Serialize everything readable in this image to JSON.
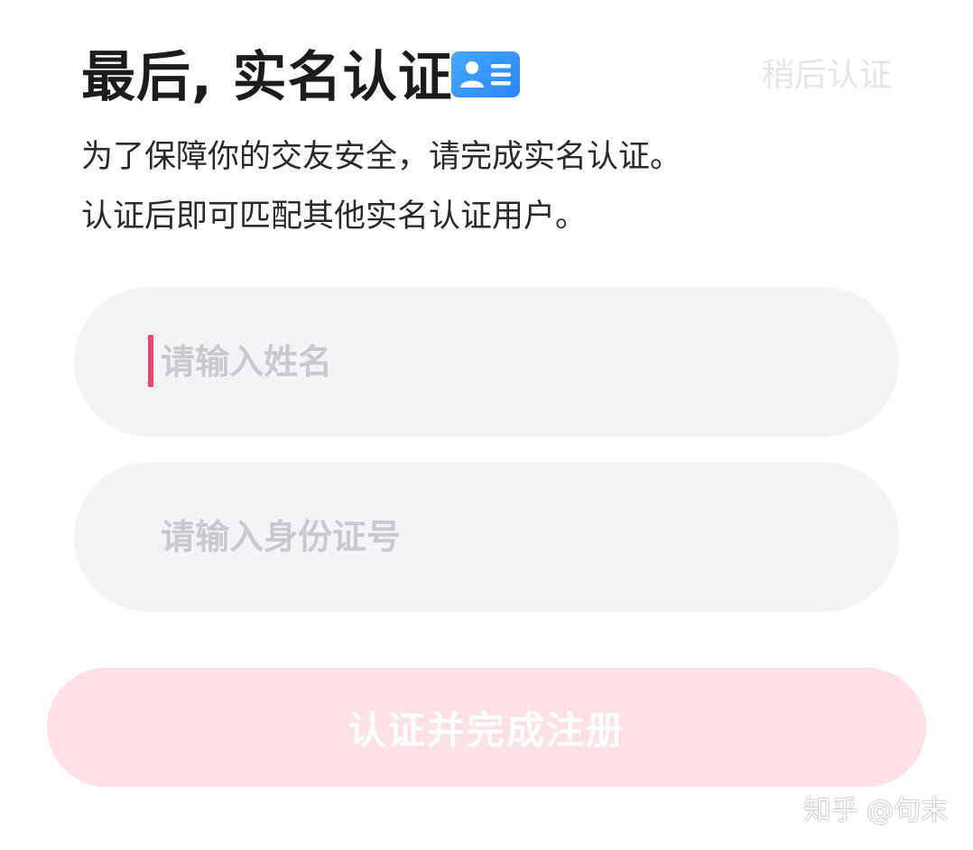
{
  "header": {
    "title": "最后, 实名认证",
    "title_icon": "id-card-icon",
    "skip_label": "稍后认证"
  },
  "description": {
    "line1": "为了保障你的交友安全，请完成实名认证。",
    "line2": "认证后即可匹配其他实名认证用户。"
  },
  "form": {
    "name_input": {
      "value": "",
      "placeholder": "请输入姓名"
    },
    "id_input": {
      "value": "",
      "placeholder": "请输入身份证号"
    },
    "submit_label": "认证并完成注册"
  },
  "watermark": "知乎 @句末",
  "colors": {
    "accent": "#e8476f",
    "submit_disabled_bg": "#fde1e7",
    "badge_blue": "#2a86ff",
    "input_bg": "#f4f4f6"
  }
}
